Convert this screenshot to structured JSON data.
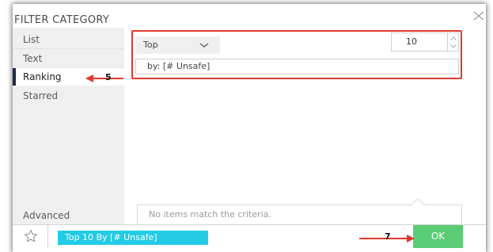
{
  "dialog": {
    "title": "FILTER CATEGORY"
  },
  "sidebar": {
    "items": [
      {
        "label": "List",
        "active": false
      },
      {
        "label": "Text",
        "active": false
      },
      {
        "label": "Ranking",
        "active": true
      },
      {
        "label": "Starred",
        "active": false
      }
    ],
    "advanced_label": "Advanced"
  },
  "ranking": {
    "mode_selected": "Top",
    "count_value": "10",
    "by_value": "by: [# Unsafe]"
  },
  "results": {
    "empty_message": "No items match the criteria."
  },
  "footer": {
    "summary": "Top 10 By [# Unsafe]",
    "ok_label": "OK"
  },
  "annotations": {
    "step_5": "5",
    "step_7": "7"
  },
  "colors": {
    "highlight_border": "#e0392b",
    "ok_green": "#5acc74",
    "summary_cyan": "#22cbe6",
    "active_bar": "#1f2a44"
  },
  "icons": {
    "close": "close-icon",
    "chevron": "chevron-down-icon",
    "star": "star-outline-icon",
    "arrow": "red-arrow-icon"
  }
}
